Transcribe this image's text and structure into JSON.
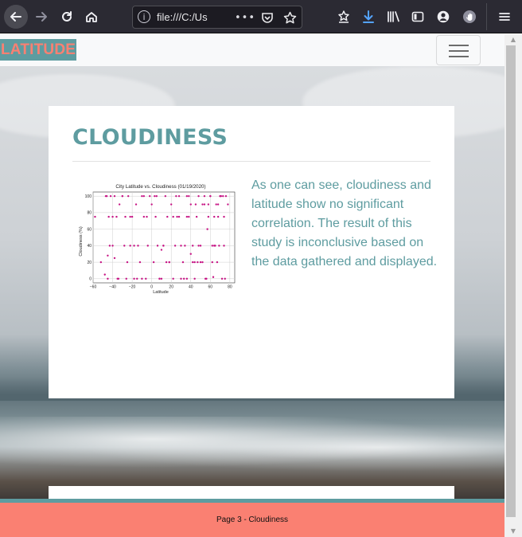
{
  "browser": {
    "url_visible": "file:///C:/Us",
    "icons": [
      "back-arrow-icon",
      "forward-arrow-icon",
      "reload-icon",
      "home-icon",
      "info-icon",
      "more-dots-icon",
      "pocket-icon",
      "bookmark-star-icon",
      "reading-list-icon",
      "download-icon",
      "library-icon",
      "sidebar-icon",
      "account-icon",
      "extension-icon",
      "menu-icon"
    ]
  },
  "navbar": {
    "brand": "LATITUDE",
    "toggle_icon": "hamburger-menu-icon"
  },
  "content": {
    "title": "CLOUDINESS",
    "description": "As one can see, cloudiness and latitude show no significant correlation. The result of this study is inconclusive based on the data gathered and displayed."
  },
  "footer": {
    "text": "Page 3 - Cloudiness"
  },
  "colors": {
    "brand_teal": "#5e9ca0",
    "brand_salmon": "#fa8072",
    "marker": "#c71585"
  },
  "chart_data": {
    "type": "scatter",
    "title": "City Latitude vs. Cloudiness (01/19/2020)",
    "xlabel": "Latitude",
    "ylabel": "Cloudiness (%)",
    "xlim": [
      -60,
      85
    ],
    "ylim": [
      -5,
      105
    ],
    "xticks": [
      -60,
      -40,
      -20,
      0,
      20,
      40,
      60,
      80
    ],
    "yticks": [
      0,
      20,
      40,
      60,
      80,
      100
    ],
    "grid": true,
    "x": [
      -58,
      -52,
      -48,
      -46,
      -45,
      -44,
      -42,
      -40,
      -38,
      -36,
      -34,
      -33,
      -30,
      -28,
      -27,
      -25,
      -24,
      -22,
      -20,
      -18,
      -16,
      -14,
      -12,
      -10,
      -8,
      -6,
      -4,
      -2,
      0,
      2,
      4,
      6,
      8,
      10,
      12,
      14,
      16,
      18,
      20,
      22,
      24,
      26,
      28,
      30,
      32,
      34,
      36,
      38,
      40,
      42,
      44,
      46,
      48,
      50,
      52,
      54,
      56,
      58,
      60,
      62,
      64,
      66,
      68,
      70,
      72,
      74,
      76,
      78,
      -45,
      -38,
      -35,
      -30,
      -22,
      -15,
      -8,
      5,
      12,
      18,
      25,
      33,
      38,
      42,
      47,
      52,
      55,
      60,
      64,
      67,
      70,
      73,
      75,
      -47,
      -40,
      -26,
      -18,
      -5,
      8,
      15,
      22,
      30,
      36,
      45,
      50,
      57,
      62,
      68,
      71,
      74,
      36,
      44,
      58,
      65,
      10,
      28,
      48,
      54,
      -43,
      -10,
      3,
      40,
      63,
      69
    ],
    "y": [
      75,
      20,
      5,
      100,
      0,
      75,
      100,
      40,
      100,
      75,
      0,
      90,
      100,
      40,
      75,
      20,
      100,
      40,
      75,
      0,
      90,
      40,
      20,
      100,
      75,
      0,
      40,
      100,
      90,
      20,
      75,
      40,
      0,
      35,
      40,
      100,
      75,
      20,
      90,
      0,
      40,
      75,
      100,
      0,
      20,
      40,
      75,
      100,
      90,
      20,
      0,
      75,
      100,
      40,
      20,
      90,
      0,
      75,
      100,
      20,
      40,
      90,
      75,
      100,
      0,
      40,
      100,
      90,
      28,
      25,
      0,
      100,
      75,
      0,
      100,
      100,
      40,
      20,
      100,
      0,
      75,
      40,
      20,
      90,
      0,
      100,
      75,
      20,
      100,
      100,
      0,
      100,
      75,
      0,
      40,
      75,
      0,
      20,
      75,
      40,
      100,
      90,
      20,
      60,
      40,
      90,
      100,
      75,
      0,
      20,
      90,
      40,
      0,
      75,
      40,
      100,
      40,
      0,
      100,
      30,
      2,
      40,
      100
    ]
  }
}
